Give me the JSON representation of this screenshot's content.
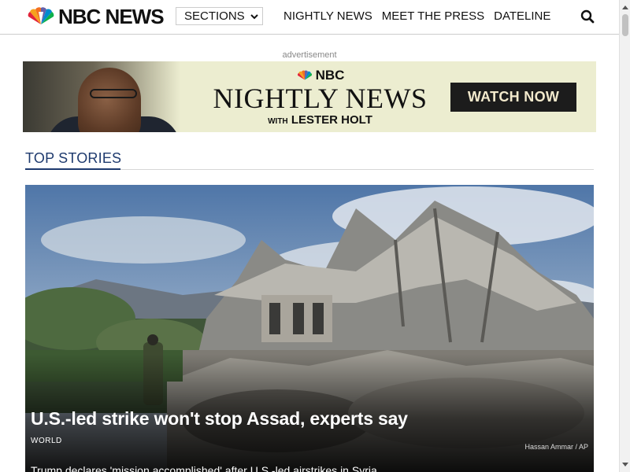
{
  "header": {
    "logo_text": "NBC NEWS",
    "sections_label": "SECTIONS",
    "nav": [
      "NIGHTLY NEWS",
      "MEET THE PRESS",
      "DATELINE"
    ]
  },
  "ad": {
    "label": "advertisement",
    "brand": "NBC",
    "title": "NIGHTLY NEWS",
    "sub_with": "WITH",
    "sub_host": "LESTER HOLT",
    "cta": "WATCH NOW"
  },
  "top_stories": {
    "title": "TOP STORIES",
    "hero": {
      "headline": "U.S.-led strike won't stop Assad, experts say",
      "category": "WORLD",
      "credit": "Hassan Ammar / AP",
      "dek": "Trump declares 'mission accomplished' after U.S.-led airstrikes in Syria"
    }
  },
  "icons": {
    "logo": "nbc-peacock-icon",
    "sections_chevron": "chevron-down-icon",
    "search": "search-icon",
    "scroll_up": "arrow-up-icon",
    "scroll_down": "arrow-down-icon"
  },
  "colors": {
    "section_title": "#1e3a6e",
    "ad_bg": "#ecedd0",
    "ad_cta_bg": "#1c1c1c"
  }
}
